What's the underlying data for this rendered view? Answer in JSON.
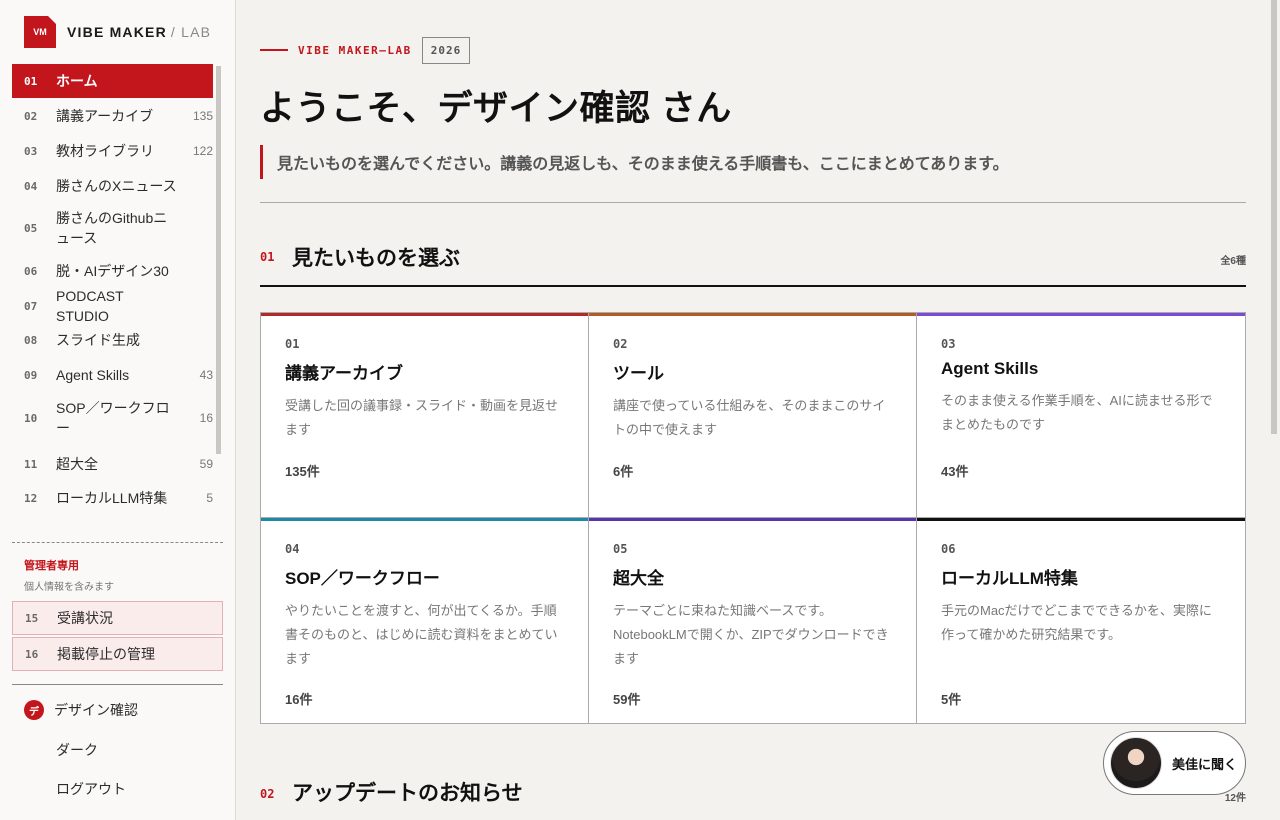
{
  "brand": {
    "logo": "VM",
    "name": "VIBE MAKER",
    "lab": "/ LAB"
  },
  "nav": [
    {
      "num": "01",
      "label": "ホーム",
      "count": "",
      "active": true
    },
    {
      "num": "02",
      "label": "講義アーカイブ",
      "count": "135"
    },
    {
      "num": "03",
      "label": "教材ライブラリ",
      "count": "122"
    },
    {
      "num": "04",
      "label": "勝さんのXニュース",
      "count": ""
    },
    {
      "num": "05",
      "label": "勝さんのGithubニュース",
      "count": ""
    },
    {
      "num": "06",
      "label": "脱・AIデザイン30",
      "count": ""
    },
    {
      "num": "07",
      "label": "PODCAST STUDIO",
      "count": ""
    },
    {
      "num": "08",
      "label": "スライド生成",
      "count": ""
    },
    {
      "num": "09",
      "label": "Agent Skills",
      "count": "43"
    },
    {
      "num": "10",
      "label": "SOP／ワークフロー",
      "count": "16"
    },
    {
      "num": "11",
      "label": "超大全",
      "count": "59"
    },
    {
      "num": "12",
      "label": "ローカルLLM特集",
      "count": "5"
    }
  ],
  "admin": {
    "title": "管理者専用",
    "subtitle": "個人情報を含みます",
    "items": [
      {
        "num": "15",
        "label": "受講状況"
      },
      {
        "num": "16",
        "label": "掲載停止の管理"
      }
    ]
  },
  "user": {
    "avatar": "デ",
    "name": "デザイン確認"
  },
  "theme_label": "ダーク",
  "logout_label": "ログアウト",
  "eyebrow": {
    "text": "VIBE MAKER—LAB",
    "year": "2026"
  },
  "welcome": "ようこそ、デザイン確認 さん",
  "lead": "見たいものを選んでください。講義の見返しも、そのまま使える手順書も、ここにまとめてあります。",
  "section1": {
    "num": "01",
    "title": "見たいものを選ぶ",
    "count": "全6種"
  },
  "cards": [
    {
      "num": "01",
      "title": "講義アーカイブ",
      "desc": "受講した回の議事録・スライド・動画を見返せます",
      "count": "135件",
      "color": "#b5282a"
    },
    {
      "num": "02",
      "title": "ツール",
      "desc": "講座で使っている仕組みを、そのままこのサイトの中で使えます",
      "count": "6件",
      "color": "#b25c22"
    },
    {
      "num": "03",
      "title": "Agent Skills",
      "desc": "そのまま使える作業手順を、AIに読ませる形でまとめたものです",
      "count": "43件",
      "color": "#7b4ad6"
    },
    {
      "num": "04",
      "title": "SOP／ワークフロー",
      "desc": "やりたいことを渡すと、何が出てくるか。手順書そのものと、はじめに読む資料をまとめています",
      "count": "16件",
      "color": "#1d8aa3"
    },
    {
      "num": "05",
      "title": "超大全",
      "desc": "テーマごとに束ねた知識ベースです。NotebookLMで開くか、ZIPでダウンロードできます",
      "count": "59件",
      "color": "#5a33b3"
    },
    {
      "num": "06",
      "title": "ローカルLLM特集",
      "desc": "手元のMacだけでどこまでできるかを、実際に作って確かめた研究結果です。",
      "count": "5件",
      "color": "#111111"
    }
  ],
  "section2": {
    "num": "02",
    "title": "アップデートのお知らせ",
    "count": "12件"
  },
  "ask": {
    "label": "美佳に聞く"
  }
}
